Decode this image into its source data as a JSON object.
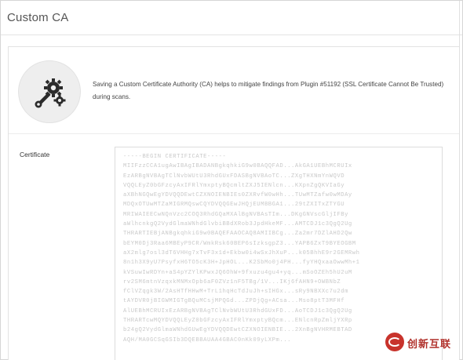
{
  "header": {
    "title": "Custom CA"
  },
  "icon": {
    "name": "gears-wrench-icon"
  },
  "info": {
    "description": "Saving a Custom Certificate Authority (CA) helps to mitigate findings from Plugin #51192 (SSL Certificate Cannot Be Trusted) during scans."
  },
  "certificate": {
    "label": "Certificate",
    "value": "-----BEGIN CERTIFICATE-----\nMIIFzzCCA1ugAwIBAgIBADANBgkqhkiG9w0BAQQFAD...AkGA1UEBhMCRUIx\nEzARBgNVBAgTClNvbWUtU3RhdGUxFDASBgNVBAoTC...ZXgTHXNmYnWQVD\nVQQLEyZ0bGFzcyAxIFRlYmxptyBQcmltZXJ5IENlcn...KXpnZgQKVIaGy\naXBhNGQwEgYDVQQDEwtCZXNOIENBIEs0ZXRvfW0wHh...TUwMTZafw0wMDAy\nMDQxOTUwMTZaMIGRMQswCQYDVQQGEwJHQjEUMBBGA1...29tZXITxZTYGU\nMRIWAIEECwNQnVzc2COQ3RhdGQaMXAlBgNVBAsTIm...DKgGNVscGljIFBy\naWlhcnkgQ2VydGlmaWNhdGlvbiBBdXRob3JpdHkeMF...AMTCDJ1c3QgQ2Ug\nTHRARTIEBjANBgkqhkiG9w0BAQEFAAOCAQ8AMIIBCg...Za2mr7DZlAHD2Qw\nbEYM0Dj3Raa6MBEyP9CR/WmkRsk60BEP6sIzksgpZ3...YAPB6ZxT9BYEOGBM\naX2mlg7osl3dT6VHHg7xTvF3x1d+Ekbw0i4wSxJhXuP...k05BhhE9r2GEMRwh\n8n1h3X9yU7PsyfxH6TO5cK3H+JpHOL...K2SbMo0j4PH...fyYHQxaaOwwMh+1\nkVSuwIwRDYn+aS4pYZYlKPwxJQ6OhW+9fxuzu4gu4+yq...mSoOZEh5hU2uM\nrv2SM6mtnVzqxkMNMxOpb6aF0ZVz1nF5TBg/1V...IKj6fAHN9+OWBNbZ\nfClVZqgk3W/2AsHTfHHwM+TrL1hqHcTdJuJh+sIHGx...sRy9NBXXc7u2dm\ntAYDVR0jBIGWMIGTgBQuMCsjMPQGd...ZPDjQg+ACsa...Mso8ptT3MFHf\nAlUEBhMCRUIxEzARBgNVBAgTClNvbWUtU3RhdGUxFD...AoTCDJ1c3QgQ2Ug\nTHRARTcwMQYDVQQLEyZ0bGFzcyAxIFRlYmxptyBQcm...ENlcnRpZmljYXRp\nb24gQ2VydGlmaWNhdGUwEgYDVQQDEwtCZXNOIENBIE...2XnBgNVHRMEBTAD\nAQH/MA0GCSqGSIb3DQEBBAUAA4GBAC0nKk09yLXPm..."
  },
  "watermark": {
    "text": "创新互联"
  }
}
